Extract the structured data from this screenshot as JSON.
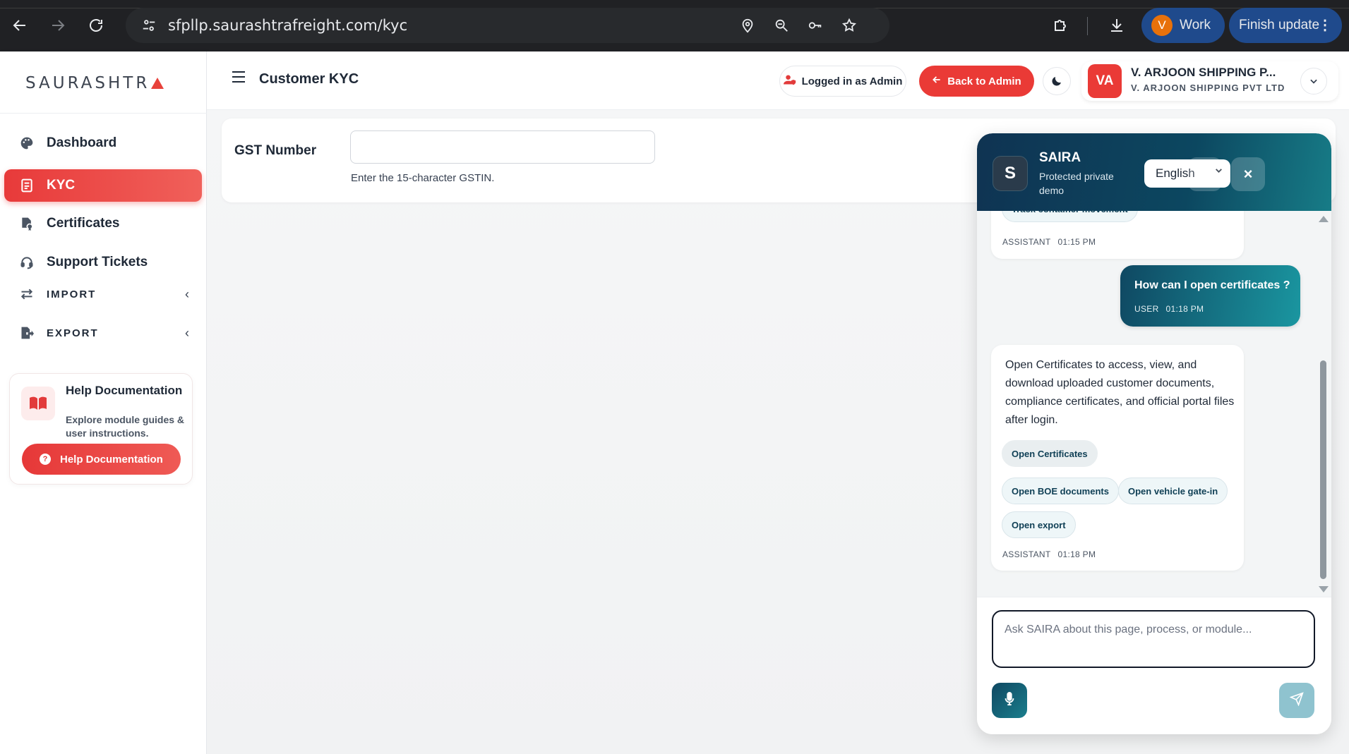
{
  "browser": {
    "url": "sfpllp.saurashtrafreight.com/kyc",
    "profile_initial": "V",
    "profile_label": "Work",
    "update_label": "Finish update"
  },
  "sidebar": {
    "logo_text": "SAURASHTR",
    "items": [
      {
        "label": "Dashboard",
        "icon": "palette-icon"
      },
      {
        "label": "KYC",
        "icon": "id-card-icon"
      },
      {
        "label": "Certificates",
        "icon": "file-certificate-icon"
      },
      {
        "label": "Support Tickets",
        "icon": "headset-icon"
      },
      {
        "label": "IMPORT",
        "icon": "swap-arrows-icon"
      },
      {
        "label": "EXPORT",
        "icon": "file-export-icon"
      }
    ],
    "help": {
      "title": "Help Documentation",
      "description": "Explore module guides & user instructions.",
      "button_label": "Help Documentation",
      "button_icon_glyph": "?"
    }
  },
  "header": {
    "title": "Customer KYC",
    "logged_in_label": "Logged in as Admin",
    "back_label": "Back to Admin",
    "company": {
      "initials": "VA",
      "name": "V. ARJOON SHIPPING P...",
      "subname": "V. ARJOON SHIPPING PVT LTD"
    }
  },
  "form": {
    "gst_label": "GST Number",
    "gst_value": "",
    "gst_help": "Enter the 15-character GSTIN."
  },
  "chat": {
    "avatar_letter": "S",
    "name": "SAIRA",
    "subtitle": "Protected private demo",
    "language": "English",
    "new_btn_glyph": "+",
    "close_btn_glyph": "×",
    "messages": [
      {
        "role": "ASSISTANT",
        "time": "01:15 PM",
        "chips": [
          "Track container movement"
        ]
      },
      {
        "role": "USER",
        "time": "01:18 PM",
        "text": "How can I open certificates ?"
      },
      {
        "role": "ASSISTANT",
        "time": "01:18 PM",
        "text": "Open Certificates to access, view, and download uploaded customer documents, compliance certificates, and official portal files after login.",
        "chips": [
          "Open Certificates",
          "Open BOE documents",
          "Open vehicle gate-in",
          "Open export"
        ]
      }
    ],
    "input_placeholder": "Ask SAIRA about this page, process, or module..."
  },
  "colors": {
    "brand_red": "#ea3a36",
    "chat_teal": "#0f4862",
    "chrome_bg": "#202124"
  }
}
